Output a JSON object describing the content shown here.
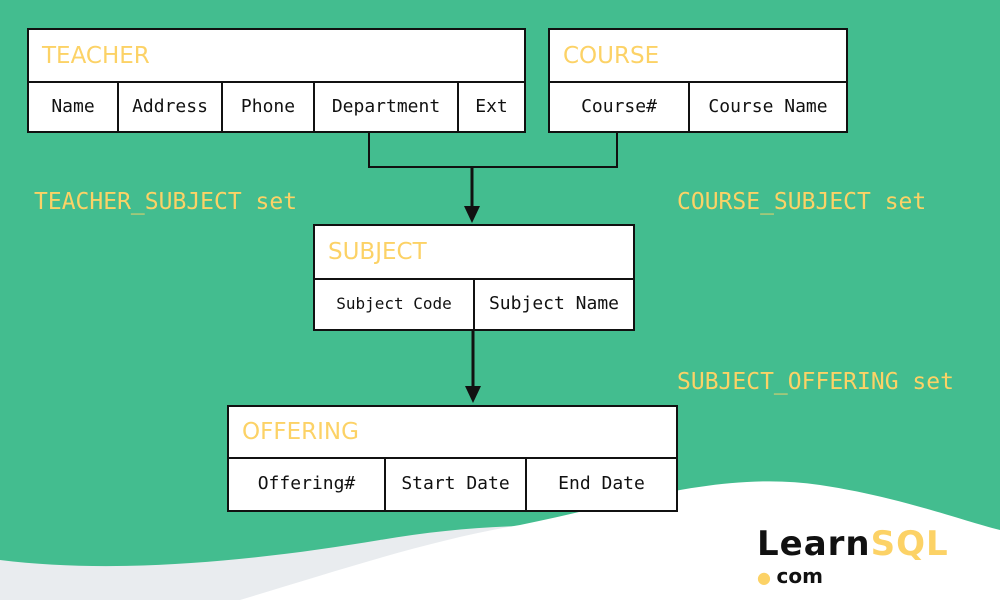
{
  "entities": {
    "teacher": {
      "title": "TEACHER",
      "fields": [
        "Name",
        "Address",
        "Phone",
        "Department",
        "Ext"
      ]
    },
    "course": {
      "title": "COURSE",
      "fields": [
        "Course#",
        "Course Name"
      ]
    },
    "subject": {
      "title": "SUBJECT",
      "fields": [
        "Subject Code",
        "Subject Name"
      ]
    },
    "offering": {
      "title": "OFFERING",
      "fields": [
        "Offering#",
        "Start Date",
        "End Date"
      ]
    }
  },
  "sets": {
    "teacher_subject": "TEACHER_SUBJECT set",
    "course_subject": "COURSE_SUBJECT set",
    "subject_offering": "SUBJECT_OFFERING set"
  },
  "logo": {
    "brand": "Learn",
    "brand_accent": "SQL",
    "domain": "com"
  },
  "colors": {
    "background": "#43bd8f",
    "accent": "#fcd266"
  }
}
